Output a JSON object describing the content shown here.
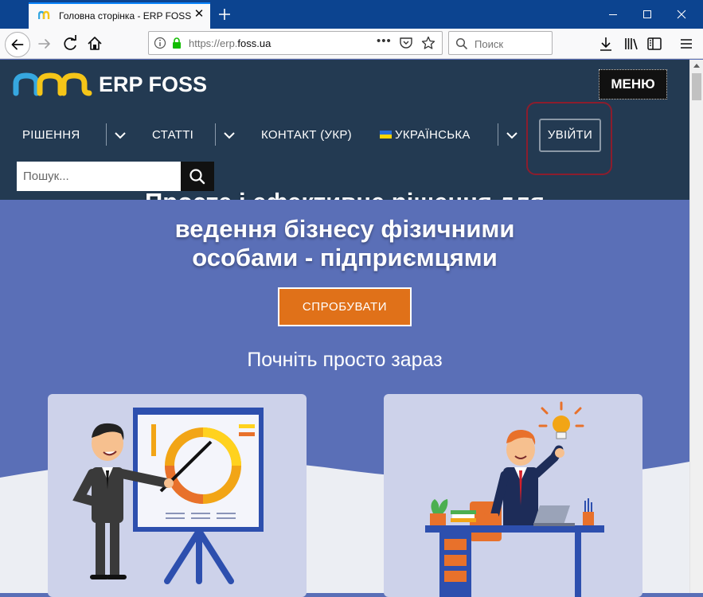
{
  "browser": {
    "tab_title": "Головна сторінка - ERP FOSS",
    "url_prefix": "https://erp.",
    "url_host": "foss.ua",
    "search_placeholder": "Поиск"
  },
  "site": {
    "logo_text": "ERP FOSS",
    "menu_label": "МЕНЮ",
    "nav": {
      "solutions": "РІШЕННЯ",
      "articles": "СТАТТІ",
      "contact": "КОНТАКТ (УКР)",
      "language": "УКРАЇНСЬКА",
      "login": "УВІЙТИ"
    },
    "search_placeholder": "Пошук..."
  },
  "hero": {
    "title_cut": "Просте і ефективне рішення для",
    "title_line2": "ведення бізнесу фізичними",
    "title_line3": "особами - підприємцями",
    "cta": "СПРОБУВАТИ",
    "subtitle": "Почніть просто зараз"
  },
  "colors": {
    "header_bg": "#233a52",
    "hero_bg": "#5a6fb7",
    "cta": "#e07119",
    "login_highlight": "#8c1d2d",
    "browser_accent": "#0c4490"
  }
}
